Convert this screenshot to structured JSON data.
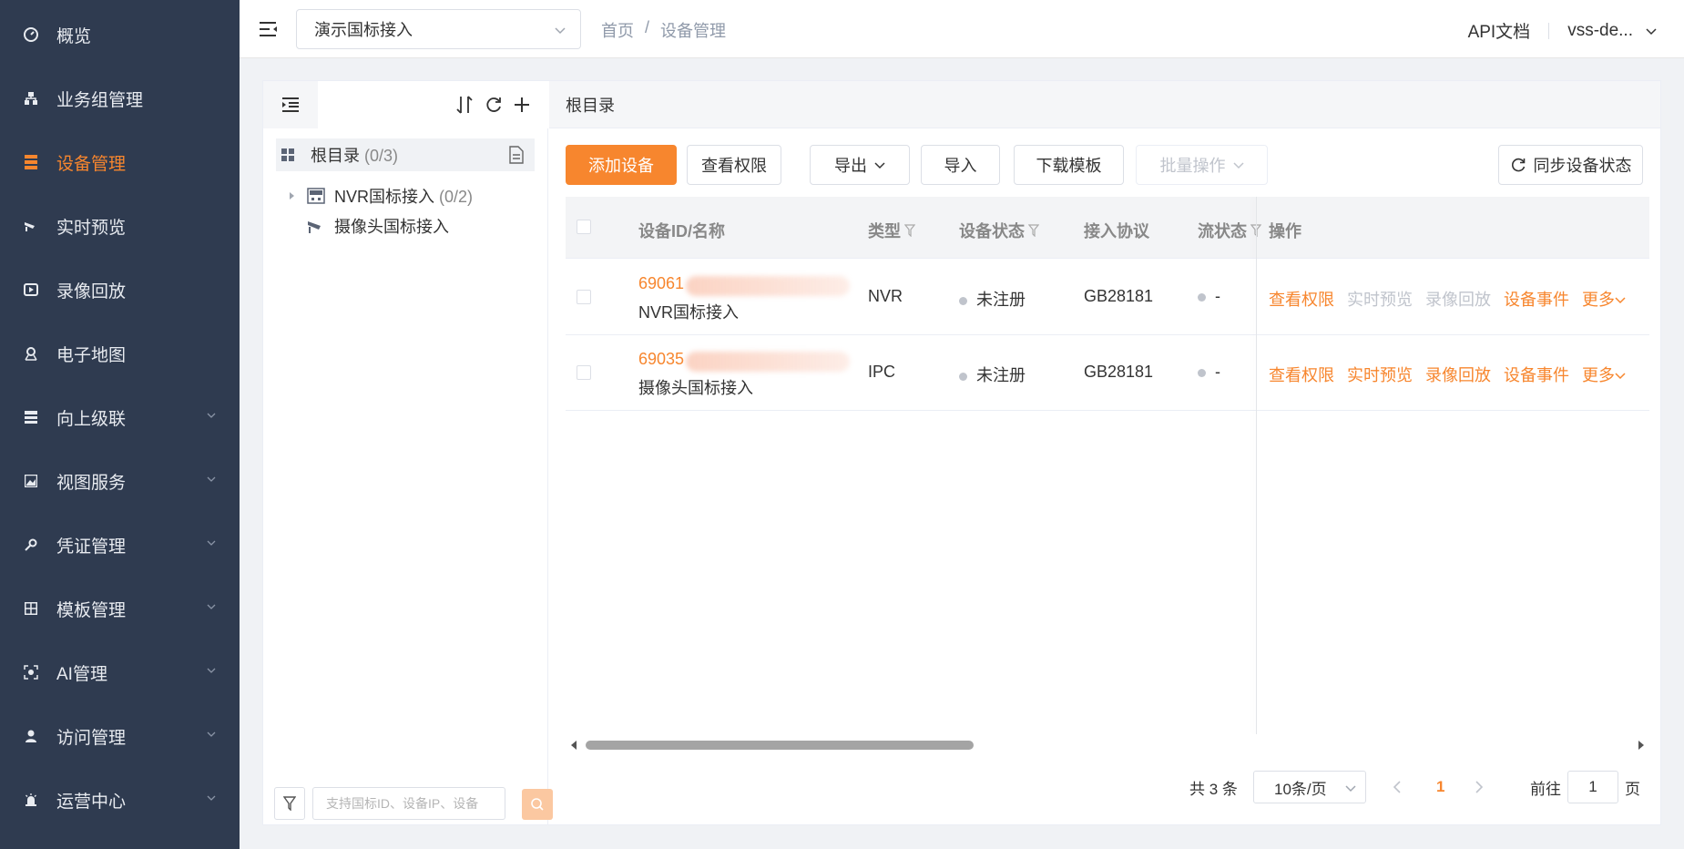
{
  "sidebar": {
    "items": [
      {
        "label": "概览",
        "icon": "dashboard-icon",
        "active": false,
        "expandable": false
      },
      {
        "label": "业务组管理",
        "icon": "org-tree-icon",
        "active": false,
        "expandable": false
      },
      {
        "label": "设备管理",
        "icon": "device-list-icon",
        "active": true,
        "expandable": false
      },
      {
        "label": "实时预览",
        "icon": "camera-icon",
        "active": false,
        "expandable": false
      },
      {
        "label": "录像回放",
        "icon": "playback-icon",
        "active": false,
        "expandable": false
      },
      {
        "label": "电子地图",
        "icon": "map-pin-icon",
        "active": false,
        "expandable": false
      },
      {
        "label": "向上级联",
        "icon": "cascade-icon",
        "active": false,
        "expandable": true
      },
      {
        "label": "视图服务",
        "icon": "image-icon",
        "active": false,
        "expandable": true
      },
      {
        "label": "凭证管理",
        "icon": "key-icon",
        "active": false,
        "expandable": true
      },
      {
        "label": "模板管理",
        "icon": "template-grid-icon",
        "active": false,
        "expandable": true
      },
      {
        "label": "AI管理",
        "icon": "ai-icon",
        "active": false,
        "expandable": true
      },
      {
        "label": "访问管理",
        "icon": "user-icon",
        "active": false,
        "expandable": true
      },
      {
        "label": "运营中心",
        "icon": "alarm-icon",
        "active": false,
        "expandable": true
      }
    ]
  },
  "header": {
    "project": "演示国标接入",
    "breadcrumb": {
      "home": "首页",
      "sep": "/",
      "current": "设备管理"
    },
    "api_doc": "API文档",
    "user": "vss-de..."
  },
  "tree": {
    "root_label": "根目录",
    "root_count": "(0/3)",
    "nodes": [
      {
        "label": "NVR国标接入",
        "count": "(0/2)"
      },
      {
        "label": "摄像头国标接入",
        "count": ""
      }
    ],
    "search_placeholder": "支持国标ID、设备IP、设备"
  },
  "content": {
    "title": "根目录",
    "buttons": {
      "add": "添加设备",
      "view_perm": "查看权限",
      "export": "导出",
      "import": "导入",
      "download_tpl": "下载模板",
      "batch": "批量操作",
      "sync": "同步设备状态"
    }
  },
  "table": {
    "columns": [
      "设备ID/名称",
      "类型",
      "设备状态",
      "接入协议",
      "流状态",
      "操作"
    ],
    "rows": [
      {
        "id_prefix": "69061",
        "name": "NVR国标接入",
        "type": "NVR",
        "status": "未注册",
        "protocol": "GB28181",
        "stream": "-",
        "ops": [
          {
            "label": "查看权限",
            "enabled": true
          },
          {
            "label": "实时预览",
            "enabled": false
          },
          {
            "label": "录像回放",
            "enabled": false
          },
          {
            "label": "设备事件",
            "enabled": true
          },
          {
            "label": "更多",
            "enabled": true
          }
        ]
      },
      {
        "id_prefix": "69035",
        "name": "摄像头国标接入",
        "type": "IPC",
        "status": "未注册",
        "protocol": "GB28181",
        "stream": "-",
        "ops": [
          {
            "label": "查看权限",
            "enabled": true
          },
          {
            "label": "实时预览",
            "enabled": true
          },
          {
            "label": "录像回放",
            "enabled": true
          },
          {
            "label": "设备事件",
            "enabled": true
          },
          {
            "label": "更多",
            "enabled": true
          }
        ]
      }
    ]
  },
  "pagination": {
    "total": "共 3 条",
    "page_size": "10条/页",
    "current_page": "1",
    "goto_prefix": "前往",
    "goto_value": "1",
    "goto_suffix": "页"
  },
  "colors": {
    "accent": "#f7862e",
    "sidebar_bg": "#2f3b50",
    "disabled": "#c0c4cc"
  }
}
